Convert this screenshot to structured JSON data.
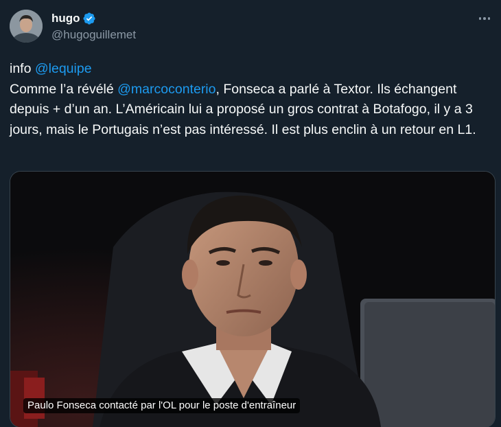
{
  "author": {
    "display_name": "hugo",
    "handle": "@hugoguillemet",
    "verified": true
  },
  "menu": {
    "icon": "more-horizontal-icon"
  },
  "tweet": {
    "line1_prefix": "info ",
    "line1_mention": "@lequipe",
    "body_prefix": "Comme l’a révélé ",
    "body_mention": "@marcoconterio",
    "body_rest": ", Fonseca a parlé à Textor. Ils échangent depuis + d’un an. L’Américain lui a proposé un gros contrat à Botafogo, il y a 3 jours, mais le Portugais n’est pas intéressé. Il est plus enclin à un retour en L1."
  },
  "media": {
    "caption": "Paulo Fonseca contacté par l'OL pour le poste d'entraîneur"
  },
  "colors": {
    "background": "#15202b",
    "text": "#f7f9f9",
    "secondary": "#8b98a5",
    "accent": "#1d9bf0",
    "border": "#38444d"
  }
}
